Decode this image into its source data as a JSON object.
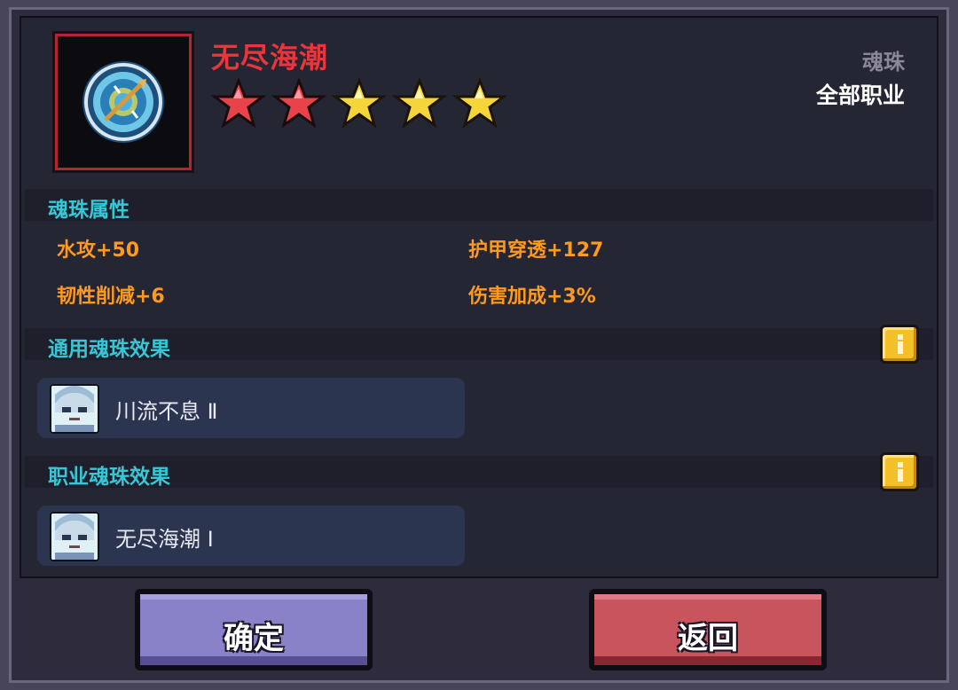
{
  "item": {
    "name": "无尽海潮",
    "type": "魂珠",
    "class": "全部职业",
    "stars_total": 5,
    "stars_red": 2,
    "icon": "water-orb-icon"
  },
  "attributes": {
    "title": "魂珠属性",
    "list": [
      "水攻+50",
      "护甲穿透+127",
      "韧性削减+6",
      "伤害加成+3%"
    ]
  },
  "common_effect": {
    "title": "通用魂珠效果",
    "effect": "川流不息 Ⅱ",
    "help_icon": "info-icon"
  },
  "class_effect": {
    "title": "职业魂珠效果",
    "effect": "无尽海潮 Ⅰ",
    "help_icon": "info-icon"
  },
  "buttons": {
    "confirm": "确定",
    "back": "返回"
  },
  "colors": {
    "name": "#e8363c",
    "section_title": "#37c6d6",
    "attribute": "#ff9a1e",
    "star_red": "#e8424a",
    "star_gold": "#f5d53a"
  }
}
